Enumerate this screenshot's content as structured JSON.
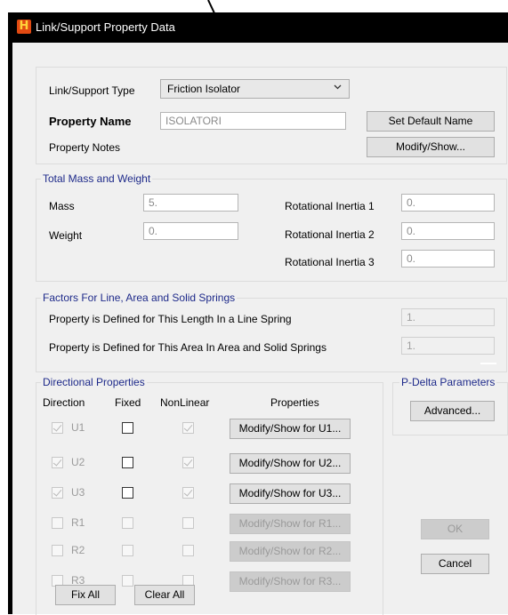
{
  "window": {
    "title": "Link/Support Property Data"
  },
  "general": {
    "type_label": "Link/Support Type",
    "type_value": "Friction Isolator",
    "name_label": "Property Name",
    "name_value": "ISOLATORI",
    "notes_label": "Property Notes",
    "set_default_label": "Set Default Name",
    "modify_show_label": "Modify/Show..."
  },
  "mass_weight": {
    "title": "Total Mass and Weight",
    "mass_label": "Mass",
    "mass_value": "5.",
    "weight_label": "Weight",
    "weight_value": "0.",
    "ri1_label": "Rotational Inertia 1",
    "ri1_value": "0.",
    "ri2_label": "Rotational Inertia 2",
    "ri2_value": "0.",
    "ri3_label": "Rotational Inertia 3",
    "ri3_value": "0."
  },
  "factors": {
    "title": "Factors For Line, Area and Solid Springs",
    "line_label": "Property is Defined for This Length In a Line Spring",
    "line_value": "1.",
    "area_label": "Property is Defined for This Area In Area and Solid Springs",
    "area_value": "1."
  },
  "directional": {
    "title": "Directional Properties",
    "col_direction": "Direction",
    "col_fixed": "Fixed",
    "col_nonlinear": "NonLinear",
    "col_properties": "Properties",
    "rows": [
      {
        "dir": "U1",
        "checked": true,
        "fixed": false,
        "nonlinear": true,
        "enabled": true,
        "button": "Modify/Show for U1..."
      },
      {
        "dir": "U2",
        "checked": true,
        "fixed": false,
        "nonlinear": true,
        "enabled": true,
        "button": "Modify/Show for U2..."
      },
      {
        "dir": "U3",
        "checked": true,
        "fixed": false,
        "nonlinear": true,
        "enabled": true,
        "button": "Modify/Show for U3..."
      },
      {
        "dir": "R1",
        "checked": false,
        "fixed": false,
        "nonlinear": false,
        "enabled": false,
        "button": "Modify/Show for R1..."
      },
      {
        "dir": "R2",
        "checked": false,
        "fixed": false,
        "nonlinear": false,
        "enabled": false,
        "button": "Modify/Show for R2..."
      },
      {
        "dir": "R3",
        "checked": false,
        "fixed": false,
        "nonlinear": false,
        "enabled": false,
        "button": "Modify/Show for R3..."
      }
    ],
    "fix_all_label": "Fix All",
    "clear_all_label": "Clear All"
  },
  "pdelta": {
    "title": "P-Delta Parameters",
    "advanced_label": "Advanced..."
  },
  "dialog": {
    "ok_label": "OK",
    "cancel_label": "Cancel"
  },
  "colors": {
    "titlebar": "#000000",
    "group_title": "#1e2a8a",
    "face": "#f0f0f0"
  },
  "icons": {
    "app": "app-logo-icon",
    "dropdown": "chevron-down-icon"
  }
}
